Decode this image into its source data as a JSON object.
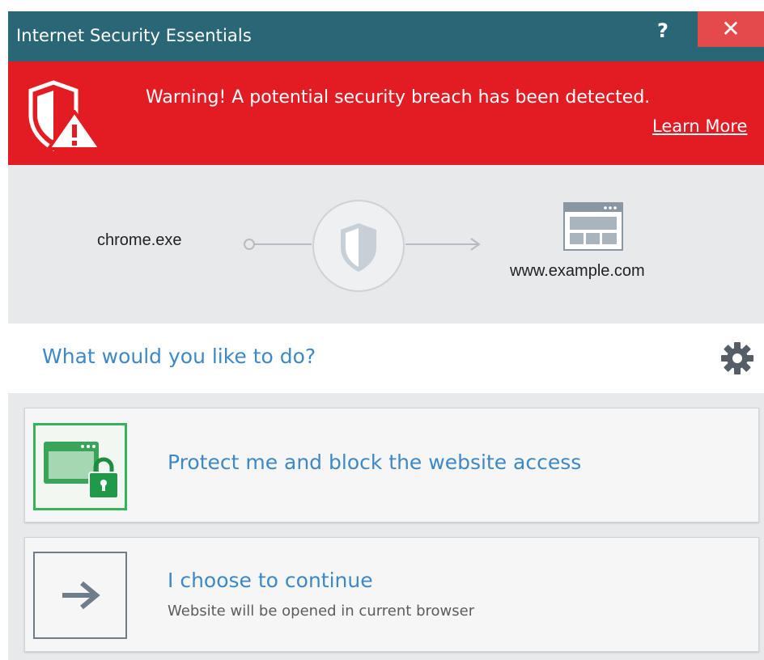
{
  "window": {
    "title": "Internet Security Essentials",
    "help_label": "?",
    "close_label": "✕"
  },
  "alert": {
    "message": "Warning! A potential security breach has been detected.",
    "learn_more": "Learn More",
    "icon": "shield-warning-icon",
    "color": "#e31c23"
  },
  "connection": {
    "process": "chrome.exe",
    "website": "www.example.com",
    "middle_icon": "shield-icon",
    "target_icon": "browser-window-icon"
  },
  "prompt": {
    "question": "What would you like to do?",
    "settings_icon": "gear-icon"
  },
  "options": [
    {
      "title": "Protect me and block the website access",
      "icon": "browser-lock-icon",
      "accent": "#34b45a"
    },
    {
      "title": "I choose to continue",
      "subtitle": "Website will be opened in current browser",
      "icon": "arrow-right-icon"
    }
  ],
  "colors": {
    "titlebar": "#2a6776",
    "close": "#e44a4b",
    "link_blue": "#3f88c6"
  }
}
